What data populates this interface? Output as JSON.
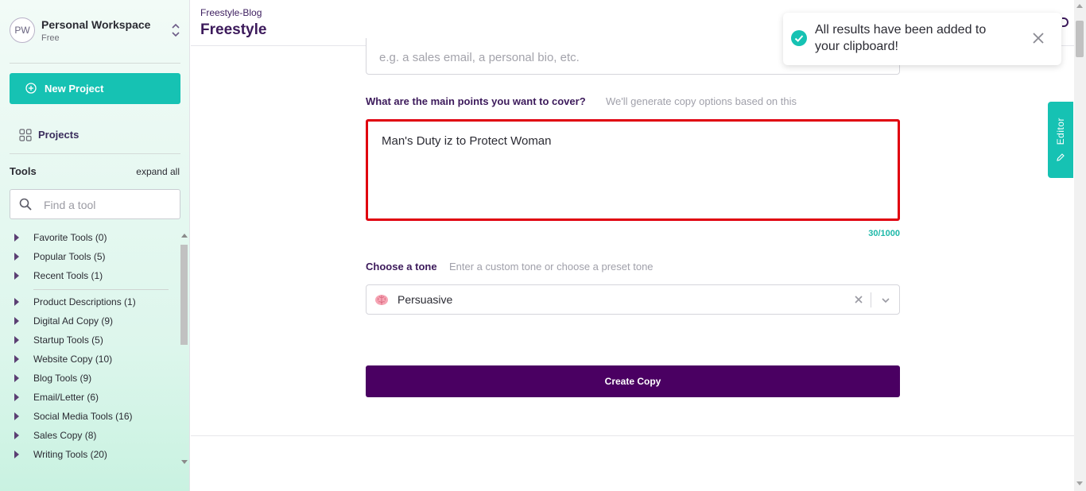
{
  "workspace": {
    "initials": "PW",
    "name": "Personal Workspace",
    "plan": "Free"
  },
  "sidebar": {
    "new_project_label": "New Project",
    "projects_label": "Projects",
    "tools_heading": "Tools",
    "expand_all_label": "expand all",
    "search_placeholder": "Find a tool",
    "tool_groups_top": [
      "Favorite Tools (0)",
      "Popular Tools (5)",
      "Recent Tools (1)"
    ],
    "tool_groups": [
      "Product Descriptions (1)",
      "Digital Ad Copy (9)",
      "Startup Tools (5)",
      "Website Copy (10)",
      "Blog Tools (9)",
      "Email/Letter (6)",
      "Social Media Tools (16)",
      "Sales Copy (8)",
      "Writing Tools (20)"
    ]
  },
  "header": {
    "breadcrumb": "Freestyle-Blog",
    "title": "Freestyle"
  },
  "form": {
    "type_placeholder": "e.g. a sales email, a personal bio, etc.",
    "points_label": "What are the main points you want to cover?",
    "points_hint": "We'll generate copy options based on this",
    "points_value": "Man's Duty iz to Protect Woman",
    "char_count": "30/1000",
    "tone_label": "Choose a tone",
    "tone_hint": "Enter a custom tone or choose a preset tone",
    "tone_value": "Persuasive",
    "tone_icon": "brain-icon",
    "create_label": "Create Copy"
  },
  "editor_tab_label": "Editor",
  "toast": {
    "message": "All results have been added to your clipboard!"
  },
  "colors": {
    "teal": "#16c2b3",
    "purple": "#4a0062",
    "heading_purple": "#3c1a5b",
    "highlight_red": "#e0000f"
  }
}
